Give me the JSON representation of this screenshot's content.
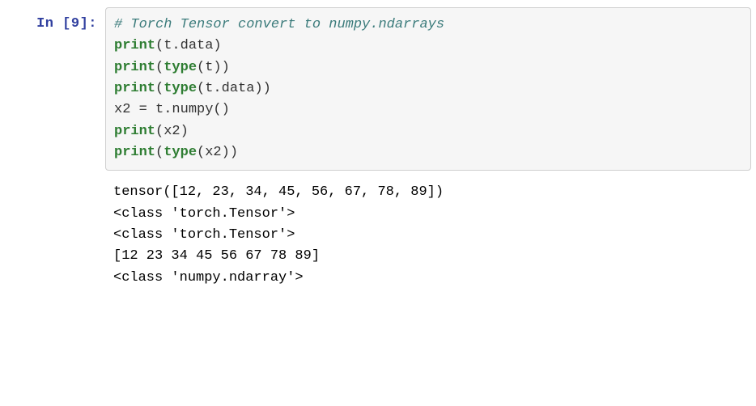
{
  "cell": {
    "prompt": "In [9]:",
    "code": {
      "c0": "# Torch Tensor convert to numpy.ndarrays",
      "l1_fn": "print",
      "l1_rest": "(t.data)",
      "l2_fn": "print",
      "l2_rest": "(",
      "l2_fn2": "type",
      "l2_rest2": "(t))",
      "l3_fn": "print",
      "l3_rest": "(",
      "l3_fn2": "type",
      "l3_rest2": "(t.data))",
      "l4": "x2 = t.numpy()",
      "l5_fn": "print",
      "l5_rest": "(x2)",
      "l6_fn": "print",
      "l6_rest": "(",
      "l6_fn2": "type",
      "l6_rest2": "(x2))"
    },
    "output": {
      "o1": "tensor([12, 23, 34, 45, 56, 67, 78, 89])",
      "o2": "<class 'torch.Tensor'>",
      "o3": "<class 'torch.Tensor'>",
      "o4": "[12 23 34 45 56 67 78 89]",
      "o5": "<class 'numpy.ndarray'>"
    }
  }
}
